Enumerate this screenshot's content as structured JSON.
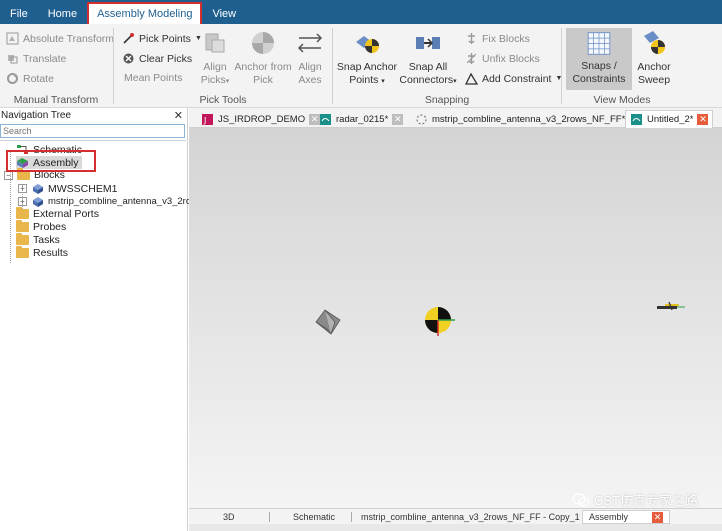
{
  "menu": {
    "tabs": [
      "File",
      "Home",
      "Assembly Modeling",
      "View"
    ],
    "active_index": 2
  },
  "ribbon": {
    "manual_transform": {
      "label": "Manual Transform",
      "absolute_transform": "Absolute Transform",
      "translate": "Translate",
      "rotate": "Rotate"
    },
    "pick_tools": {
      "label": "Pick Tools",
      "pick_points": "Pick Points",
      "clear_picks": "Clear Picks",
      "mean_points": "Mean Points",
      "align_picks_1": "Align",
      "align_picks_2": "Picks",
      "anchor_from_pick_1": "Anchor from",
      "anchor_from_pick_2": "Pick",
      "align_axes_1": "Align",
      "align_axes_2": "Axes"
    },
    "snapping": {
      "label": "Snapping",
      "snap_anchor_points_1": "Snap Anchor",
      "snap_anchor_points_2": "Points",
      "snap_all_connectors_1": "Snap All",
      "snap_all_connectors_2": "Connectors",
      "fix_blocks": "Fix Blocks",
      "unfix_blocks": "Unfix Blocks",
      "add_constraint": "Add Constraint"
    },
    "view_modes": {
      "label": "View Modes",
      "snaps_constraints_1": "Snaps /",
      "snaps_constraints_2": "Constraints",
      "anchor_sweep_1": "Anchor",
      "anchor_sweep_2": "Sweep"
    }
  },
  "nav": {
    "title": "Navigation Tree",
    "close": "✕",
    "search_placeholder": "Search",
    "items": {
      "schematic": "Schematic",
      "assembly": "Assembly",
      "blocks": "Blocks",
      "block1": "MWSSCHEM1",
      "block2": "mstrip_combline_antenna_v3_2rov",
      "external_ports": "External Ports",
      "probes": "Probes",
      "tasks": "Tasks",
      "results": "Results"
    }
  },
  "doc_tabs": [
    {
      "label": "JS_IRDROP_DEMO",
      "close": "✕"
    },
    {
      "label": "radar_0215*",
      "close": "✕"
    },
    {
      "label": "mstrip_combline_antenna_v3_2rows_NF_FF*",
      "close": "✕"
    },
    {
      "label": "Untitled_2*",
      "close": "✕"
    }
  ],
  "bottom_tabs": [
    {
      "label": "3D"
    },
    {
      "label": "Schematic"
    },
    {
      "label": "mstrip_combline_antenna_v3_2rows_NF_FF - Copy_1",
      "close": "✕"
    },
    {
      "label": "Assembly",
      "close": "✕"
    }
  ],
  "watermark": "CST仿真专家之路",
  "colors": {
    "menubar": "#1f5f8f",
    "highlight": "#d32f2f",
    "tab_close_active": "#e65c3c"
  }
}
